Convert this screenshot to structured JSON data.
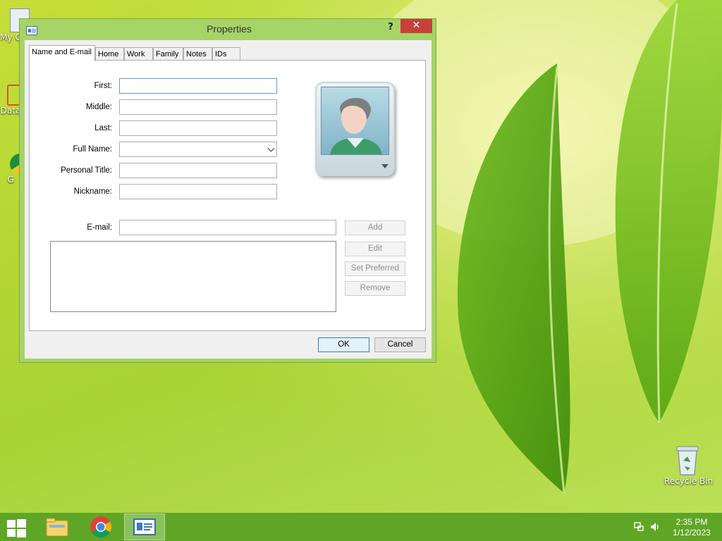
{
  "desktop": {
    "icons": [
      {
        "label": "My C",
        "icon": "computer-icon"
      },
      {
        "label": "Data",
        "icon": "database-shortcut-icon"
      },
      {
        "label": "G",
        "icon": "chrome-shortcut-icon"
      },
      {
        "label": "Recycle Bin",
        "icon": "recycle-bin-icon"
      }
    ]
  },
  "dialog": {
    "title": "Properties",
    "help_label": "?",
    "close_label": "✕",
    "tabs": [
      {
        "label": "Name and E-mail",
        "active": true
      },
      {
        "label": "Home"
      },
      {
        "label": "Work"
      },
      {
        "label": "Family"
      },
      {
        "label": "Notes"
      },
      {
        "label": "IDs"
      }
    ],
    "fields": {
      "first": {
        "label": "First:",
        "value": ""
      },
      "middle": {
        "label": "Middle:",
        "value": ""
      },
      "last": {
        "label": "Last:",
        "value": ""
      },
      "full_name": {
        "label": "Full Name:",
        "value": ""
      },
      "personal_title": {
        "label": "Personal Title:",
        "value": ""
      },
      "nickname": {
        "label": "Nickname:",
        "value": ""
      },
      "email": {
        "label": "E-mail:",
        "value": ""
      }
    },
    "email_buttons": {
      "add": "Add",
      "edit": "Edit",
      "set_preferred": "Set Preferred",
      "remove": "Remove"
    },
    "ok_label": "OK",
    "cancel_label": "Cancel"
  },
  "taskbar": {
    "apps": [
      "file-explorer-icon",
      "chrome-icon",
      "contacts-app-icon"
    ],
    "time": "2:35 PM",
    "date": "1/12/2023"
  },
  "colors": {
    "taskbar": "#5fa526",
    "dialog_frame": "#a6d466",
    "close_button": "#c7413a",
    "focus_border": "#569de5"
  }
}
